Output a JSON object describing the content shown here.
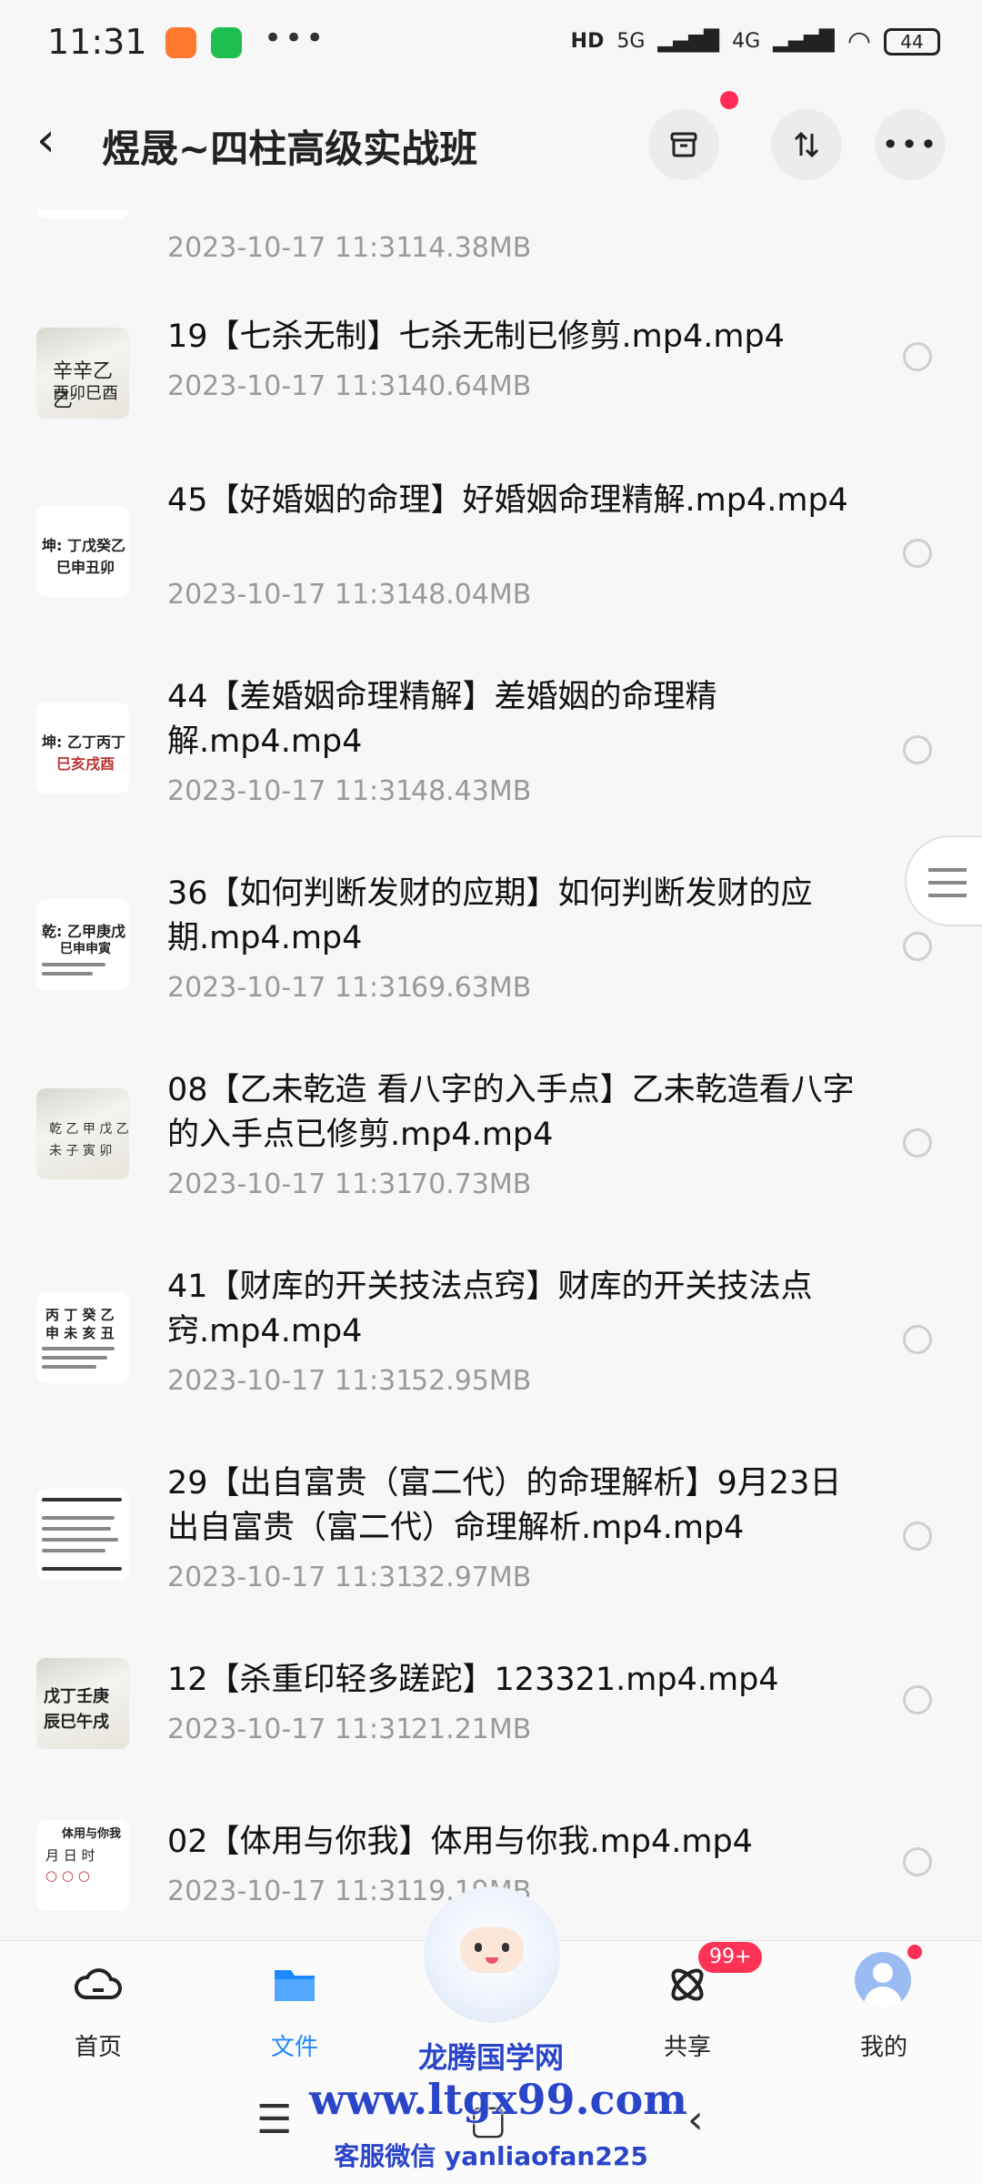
{
  "status": {
    "time": "11:31",
    "network_5g": "5G",
    "network_4g": "4G",
    "hd": "HD",
    "battery": "44"
  },
  "header": {
    "title": "煜晟~四柱高级实战班"
  },
  "files": [
    {
      "name": "",
      "date": "2023-10-17  11:31",
      "size": "14.38MB"
    },
    {
      "name": "19【七杀无制】七杀无制已修剪.mp4.mp4",
      "date": "2023-10-17  11:31",
      "size": "40.64MB"
    },
    {
      "name": "45【好婚姻的命理】好婚姻命理精解.mp4.mp4",
      "date": "2023-10-17  11:31",
      "size": "48.04MB"
    },
    {
      "name": "44【差婚姻命理精解】差婚姻的命理精解.mp4.mp4",
      "date": "2023-10-17  11:31",
      "size": "48.43MB"
    },
    {
      "name": "36【如何判断发财的应期】如何判断发财的应期.mp4.mp4",
      "date": "2023-10-17  11:31",
      "size": "69.63MB"
    },
    {
      "name": "08【乙未乾造  看八字的入手点】乙未乾造看八字的入手点已修剪.mp4.mp4",
      "date": "2023-10-17  11:31",
      "size": "70.73MB"
    },
    {
      "name": "41【财库的开关技法点窍】财库的开关技法点窍.mp4.mp4",
      "date": "2023-10-17  11:31",
      "size": "52.95MB"
    },
    {
      "name": "29【出自富贵（富二代）的命理解析】9月23日出自富贵（富二代）命理解析.mp4.mp4",
      "date": "2023-10-17  11:31",
      "size": "32.97MB"
    },
    {
      "name": "12【杀重印轻多蹉跎】123321.mp4.mp4",
      "date": "2023-10-17  11:31",
      "size": "21.21MB"
    },
    {
      "name": "02【体用与你我】体用与你我.mp4.mp4",
      "date": "2023-10-17  11:31",
      "size": "19.19MB"
    }
  ],
  "tabs": [
    {
      "label": "首页",
      "icon": "cloud-icon"
    },
    {
      "label": "文件",
      "icon": "folder-icon"
    },
    {
      "label": "",
      "icon": "mascot-icon"
    },
    {
      "label": "共享",
      "icon": "share-icon"
    },
    {
      "label": "我的",
      "icon": "profile-icon"
    }
  ],
  "share_badge": "99+",
  "watermark": {
    "site_name": "龙腾国学网",
    "url": "www.ltgx99.com",
    "contact": "客服微信 yanliaofan225"
  },
  "colors": {
    "accent": "#1e88ff",
    "badge": "#ff3355",
    "watermark": "#2b45c9"
  }
}
